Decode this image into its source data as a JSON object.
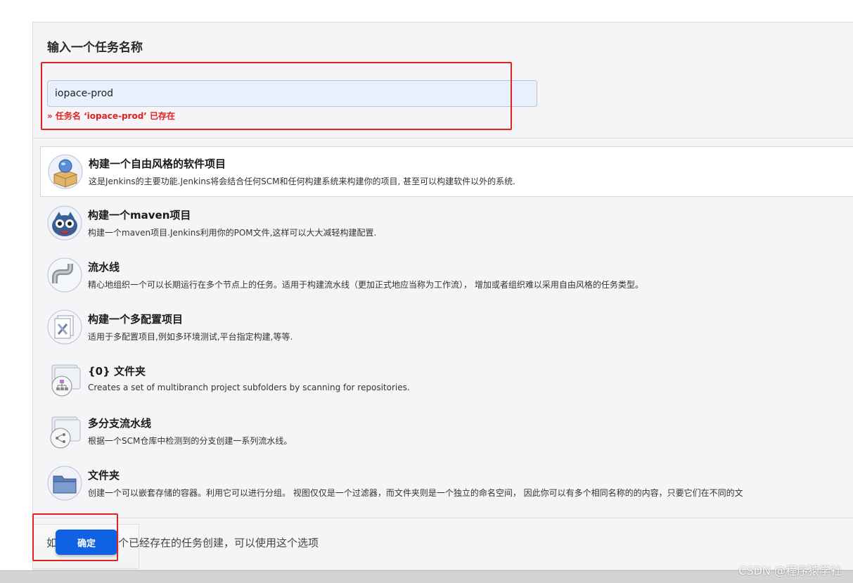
{
  "header": {
    "title": "输入一个任务名称"
  },
  "name_input": {
    "value": "iopace-prod",
    "error": "» 任务名 ‘iopace-prod’ 已存在"
  },
  "job_types": [
    {
      "title": "构建一个自由风格的软件项目",
      "desc": "这是Jenkins的主要功能.Jenkins将会结合任何SCM和任何构建系统来构建你的项目, 甚至可以构建软件以外的系统.",
      "icon": "freestyle-project-icon",
      "selected": true
    },
    {
      "title": "构建一个maven项目",
      "desc": "构建一个maven项目.Jenkins利用你的POM文件,这样可以大大减轻构建配置.",
      "icon": "maven-project-icon",
      "selected": false
    },
    {
      "title": "流水线",
      "desc": "精心地组织一个可以长期运行在多个节点上的任务。适用于构建流水线（更加正式地应当称为工作流）， 增加或者组织难以采用自由风格的任务类型。",
      "icon": "pipeline-icon",
      "selected": false
    },
    {
      "title": "构建一个多配置项目",
      "desc": "适用于多配置项目,例如多环境测试,平台指定构建,等等.",
      "icon": "multi-config-project-icon",
      "selected": false
    },
    {
      "title": "{0} 文件夹",
      "desc": "Creates a set of multibranch project subfolders by scanning for repositories.",
      "icon": "organization-folder-icon",
      "selected": false
    },
    {
      "title": "多分支流水线",
      "desc": "根据一个SCM仓库中检测到的分支创建一系列流水线。",
      "icon": "multibranch-pipeline-icon",
      "selected": false
    },
    {
      "title": "文件夹",
      "desc": "创建一个可以嵌套存储的容器。利用它可以进行分组。 视图仅仅是一个过滤器，而文件夹则是一个独立的命名空间， 因此你可以有多个相同名称的的内容，只要它们在不同的文",
      "icon": "folder-icon",
      "selected": false
    }
  ],
  "copy_section": {
    "text_partial_left": "如",
    "text_partial_right": "一个已经存在的任务创建，可以使用这个选项"
  },
  "ok_button": {
    "label": "确定"
  },
  "watermark": "CSDN @程序猿学社",
  "colors": {
    "accent": "#1062e5",
    "error": "#e02020",
    "highlight_box": "#e62020"
  }
}
